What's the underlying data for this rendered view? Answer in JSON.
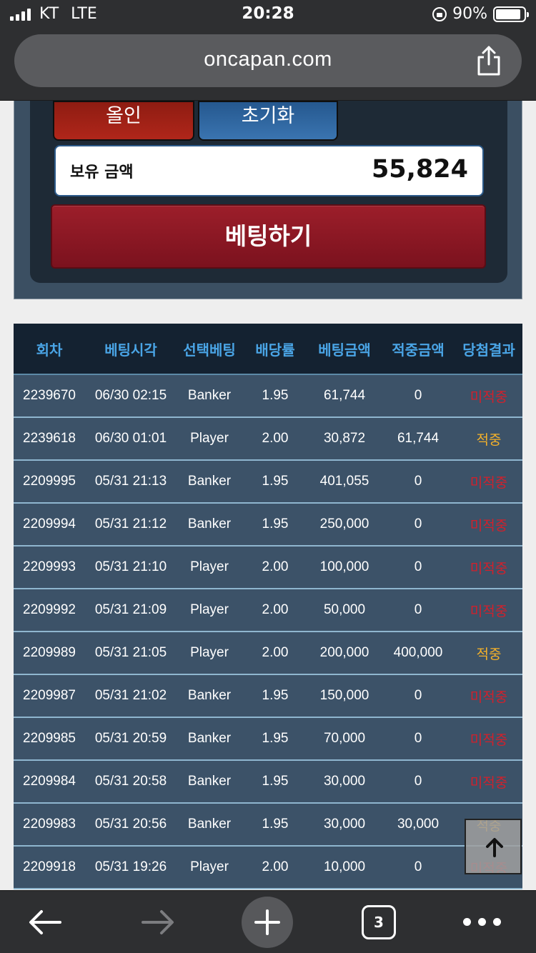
{
  "status_bar": {
    "carrier": "KT",
    "network": "LTE",
    "time": "20:28",
    "battery": "90%",
    "battery_level": 0.9
  },
  "browser": {
    "url": "oncapan.com",
    "open_tabs": "3"
  },
  "bet_panel": {
    "allin_label": "올인",
    "reset_label": "초기화",
    "balance_label": "보유 금액",
    "balance_value": "55,824",
    "bet_label": "베팅하기"
  },
  "history": {
    "headers": [
      "회차",
      "베팅시각",
      "선택베팅",
      "배당률",
      "베팅금액",
      "적중금액",
      "당첨결과"
    ],
    "rows": [
      [
        "2239670",
        "06/30 02:15",
        "Banker",
        "1.95",
        "61,744",
        "0",
        "미적중"
      ],
      [
        "2239618",
        "06/30 01:01",
        "Player",
        "2.00",
        "30,872",
        "61,744",
        "적중"
      ],
      [
        "2209995",
        "05/31 21:13",
        "Banker",
        "1.95",
        "401,055",
        "0",
        "미적중"
      ],
      [
        "2209994",
        "05/31 21:12",
        "Banker",
        "1.95",
        "250,000",
        "0",
        "미적중"
      ],
      [
        "2209993",
        "05/31 21:10",
        "Player",
        "2.00",
        "100,000",
        "0",
        "미적중"
      ],
      [
        "2209992",
        "05/31 21:09",
        "Player",
        "2.00",
        "50,000",
        "0",
        "미적중"
      ],
      [
        "2209989",
        "05/31 21:05",
        "Player",
        "2.00",
        "200,000",
        "400,000",
        "적중"
      ],
      [
        "2209987",
        "05/31 21:02",
        "Banker",
        "1.95",
        "150,000",
        "0",
        "미적중"
      ],
      [
        "2209985",
        "05/31 20:59",
        "Banker",
        "1.95",
        "70,000",
        "0",
        "미적중"
      ],
      [
        "2209984",
        "05/31 20:58",
        "Banker",
        "1.95",
        "30,000",
        "0",
        "미적중"
      ],
      [
        "2209983",
        "05/31 20:56",
        "Banker",
        "1.95",
        "30,000",
        "30,000",
        "적중"
      ],
      [
        "2209918",
        "05/31 19:26",
        "Player",
        "2.00",
        "10,000",
        "0",
        "미적중"
      ]
    ]
  },
  "colors": {
    "win": "#f4b12a",
    "lose": "#d2202b",
    "header_text": "#4aa5e6",
    "row_bg": "#3c5268",
    "bet_button": "#8e1a26"
  },
  "icons": {
    "share": "share-icon",
    "scroll_top": "arrow-up-icon",
    "back": "arrow-left-icon",
    "forward": "arrow-right-icon",
    "new_tab": "plus-icon",
    "more": "more-icon"
  }
}
